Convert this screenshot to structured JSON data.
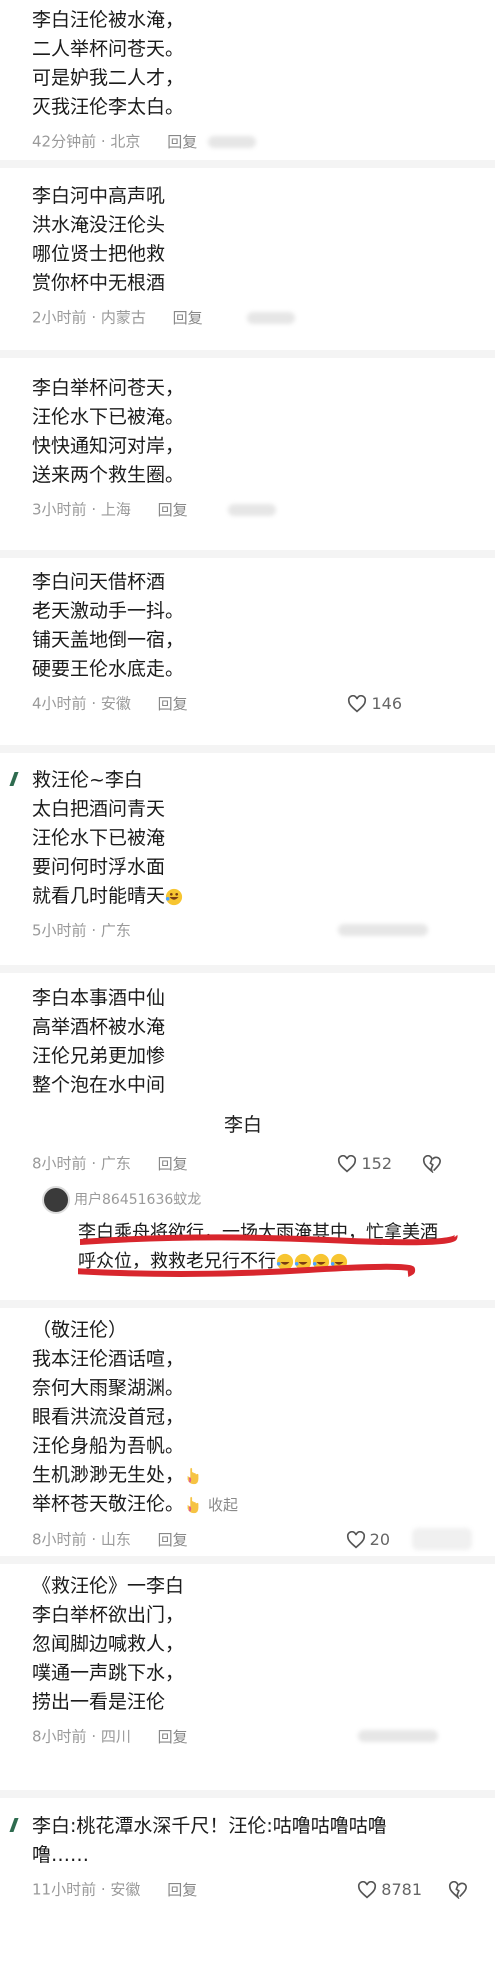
{
  "reply_label": "回复",
  "comments": [
    {
      "lines": [
        "李白汪伦被水淹，",
        "二人举杯问苍天。",
        "可是妒我二人才，",
        "灭我汪伦李太白。"
      ],
      "time": "42分钟前",
      "location": "北京"
    },
    {
      "lines": [
        "李白河中高声吼",
        "洪水淹没汪伦头",
        "哪位贤士把他救",
        "赏你杯中无根酒"
      ],
      "time": "2小时前",
      "location": "内蒙古"
    },
    {
      "lines": [
        "李白举杯问苍天，",
        "汪伦水下已被淹。",
        "快快通知河对岸，",
        "送来两个救生圈。"
      ],
      "time": "3小时前",
      "location": "上海"
    },
    {
      "lines": [
        "李白问天借杯酒",
        "老天激动手一抖。",
        "铺天盖地倒一宿，",
        "硬要王伦水底走。"
      ],
      "time": "4小时前",
      "location": "安徽",
      "likes": "146"
    },
    {
      "lines": [
        "救汪伦~李白",
        "太白把酒问青天",
        "汪伦水下已被淹",
        "要问何时浮水面",
        "就看几时能晴天"
      ],
      "time": "5小时前",
      "location": "广东"
    },
    {
      "lines": [
        "李白本事酒中仙",
        "高举酒杯被水淹",
        "汪伦兄弟更加惨",
        "整个泡在水中间"
      ],
      "signature": "李白",
      "time": "8小时前",
      "location": "广东",
      "likes": "152",
      "sub_reply": {
        "user": "用户86451636蚊龙",
        "text": "李白乘舟将欲行，一场大雨淹其中，忙拿美酒呼众位，救救老兄行不行"
      }
    },
    {
      "lines": [
        "（敬汪伦）",
        "我本汪伦酒话喧，",
        "奈何大雨聚湖渊。",
        "眼看洪流没首冠，",
        "汪伦身船为吾帆。",
        "生机渺渺无生处，",
        "举杯苍天敬汪伦。"
      ],
      "collapse": "收起",
      "time": "8小时前",
      "location": "山东",
      "likes": "20"
    },
    {
      "lines": [
        "《救汪伦》一李白",
        "李白举杯欲出门，",
        "忽闻脚边喊救人，",
        "噗通一声跳下水，",
        "捞出一看是汪伦"
      ],
      "time": "8小时前",
      "location": "四川"
    },
    {
      "lines": [
        "李白:桃花潭水深千尺！汪伦:咕噜咕噜咕噜",
        "噜……"
      ],
      "time": "11小时前",
      "location": "安徽",
      "likes": "8781"
    }
  ]
}
